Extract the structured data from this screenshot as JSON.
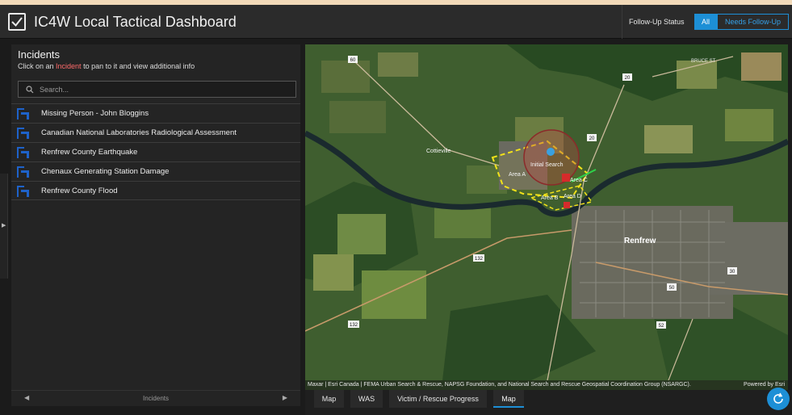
{
  "header": {
    "title": "IC4W Local Tactical Dashboard",
    "follow_up_label": "Follow-Up Status",
    "follow_up_options": [
      "All",
      "Needs Follow-Up"
    ],
    "follow_up_selected": "All"
  },
  "incidents_panel": {
    "title": "Incidents",
    "subtitle_before": "Click on an ",
    "subtitle_highlight": "Incident",
    "subtitle_after": " to pan to it and view additional info",
    "search_placeholder": "Search...",
    "items": [
      {
        "label": "Missing Person - John Bloggins"
      },
      {
        "label": "Canadian National Laboratories Radiological Assessment"
      },
      {
        "label": "Renfrew County Earthquake"
      },
      {
        "label": "Chenaux Generating Station Damage"
      },
      {
        "label": "Renfrew County Flood"
      }
    ],
    "pager_label": "Incidents"
  },
  "map": {
    "labels": {
      "town": "Renfrew",
      "cottieville": "Cottieville",
      "initial_search": "Initial Search",
      "area_a": "Area A",
      "area_b": "Area B",
      "area_c": "Area C",
      "area_d": "Area D",
      "road_60": "60",
      "road_20a": "20",
      "road_20b": "20",
      "road_132a": "132",
      "road_132b": "132",
      "road_52": "52",
      "road_30": "30",
      "road_50": "50",
      "bruce_st": "BRUCE ST"
    },
    "attribution": "Maxar | Esri Canada | FEMA Urban Search & Rescue, NAPSG Foundation, and National Search and Rescue Geospatial Coordination Group (NSARGC).",
    "powered_by": "Powered by Esri"
  },
  "bottom_tabs": [
    {
      "label": "Map"
    },
    {
      "label": "WAS"
    },
    {
      "label": "Victim / Rescue Progress"
    },
    {
      "label": "Map"
    }
  ],
  "active_bottom_tab": 3,
  "colors": {
    "accent": "#1d8fd6",
    "highlight": "#ff6b6b",
    "search_area_outline": "#f2e21a"
  },
  "icons": {
    "header_checkbox": "checkbox-checked-icon",
    "search": "search-icon",
    "incident": "incident-flag-icon",
    "fab": "refresh-icon"
  }
}
